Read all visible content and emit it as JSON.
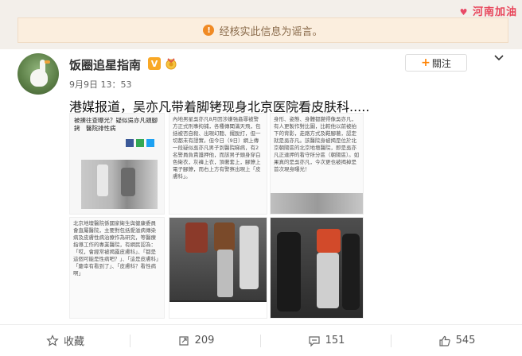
{
  "notice": {
    "text": "经核实此信息为谣言。",
    "icon": "warning-icon"
  },
  "corner_deco": "河南加油",
  "user": {
    "name": "饭圈追星指南",
    "verified_badge": "V",
    "time": "9月9日 13：53"
  },
  "follow": {
    "label": "關注",
    "plus": "+"
  },
  "post": {
    "text": "港媒报道，吴亦凡带着脚铐现身北京医院看皮肤科....."
  },
  "images": {
    "img1": {
      "headline": "被揍往查曝光？疑似吳亦凡頭腳銬　醫院排性病"
    },
    "img2": {
      "body": "內地男星吳亦凡8月因涉嫌強姦罪被警方正式刑事拘捕，各種傳聞滿天飛，包括被否自殺、出現幻聽、擺脫打，但一切都未有證實。但今日（9日）網上傳一段疑似吳亦凡男子到醫院睇病，有2名警員負責護押他，而該男子頭身穿白色衛衣，灰褲上衣，頂著套上，腳鐐上電子腳鐐，而右上方有警察出現上「皮膚科」。"
    },
    "img3": {
      "body": "身形、姿態、身體都變得像吳亦凡，有人更製作對比圖，比較他以前被拍下的背影，走路方式及鞋腳著，認定就是吳亦凡。該醫院身被揭是位於北京朝陽區的北京地壇醫院，即是吳亦凡正達押的看守所分區（朝陽區）。如果真的是吳亦凡，今次更也被揭掉是首次現身曝光！"
    },
    "img4": {
      "body": "北京地壇醫院係國家衛生與健康委員會直屬醫院，主要對包括愛滋病傳染病及皮膚性病治療作為研究，等醫療指導工作的專業醫院，有網民認為：「哎，會經常被揭露皮膚科」、「都是這個可能是性病吧？」、「這是皮膚科」「慶幸有看到了」、「皮膚科？看性病啊」"
    }
  },
  "actions": {
    "collect": {
      "label": "收藏"
    },
    "repost": {
      "count": "209"
    },
    "comment": {
      "count": "151"
    },
    "like": {
      "count": "545"
    }
  }
}
